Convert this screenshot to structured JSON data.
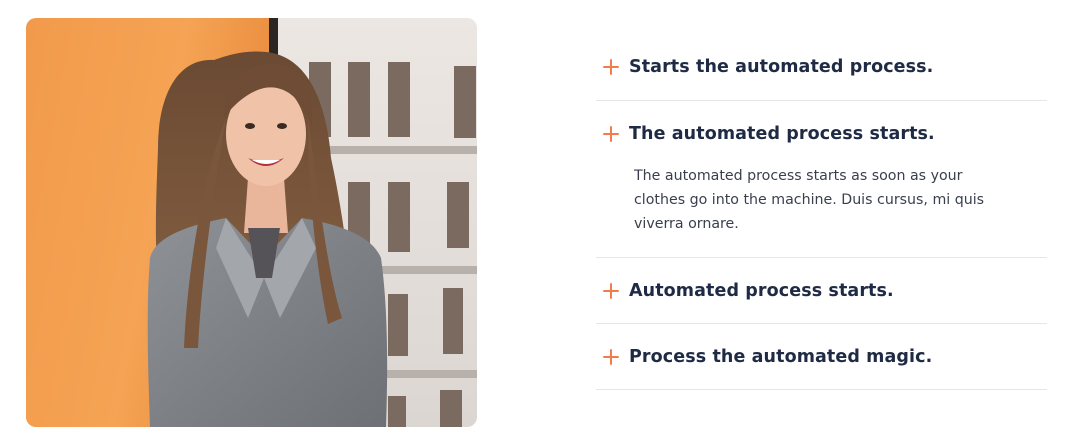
{
  "image": {
    "alt": "Smiling woman in a gray blazer"
  },
  "faq": {
    "items": [
      {
        "title": "Starts the automated process.",
        "expanded": false
      },
      {
        "title": "The automated process starts.",
        "expanded": true,
        "body": "The automated process starts as soon as your clothes go into the machine. Duis cursus, mi quis viverra ornare."
      },
      {
        "title": "Automated process starts.",
        "expanded": false
      },
      {
        "title": "Process the automated magic.",
        "expanded": false
      }
    ]
  },
  "colors": {
    "accent": "#f47b4a",
    "heading": "#1f2a44",
    "body_text": "#3a3f4d",
    "divider": "#e6e6ea"
  },
  "icons": [
    "plus-icon"
  ]
}
